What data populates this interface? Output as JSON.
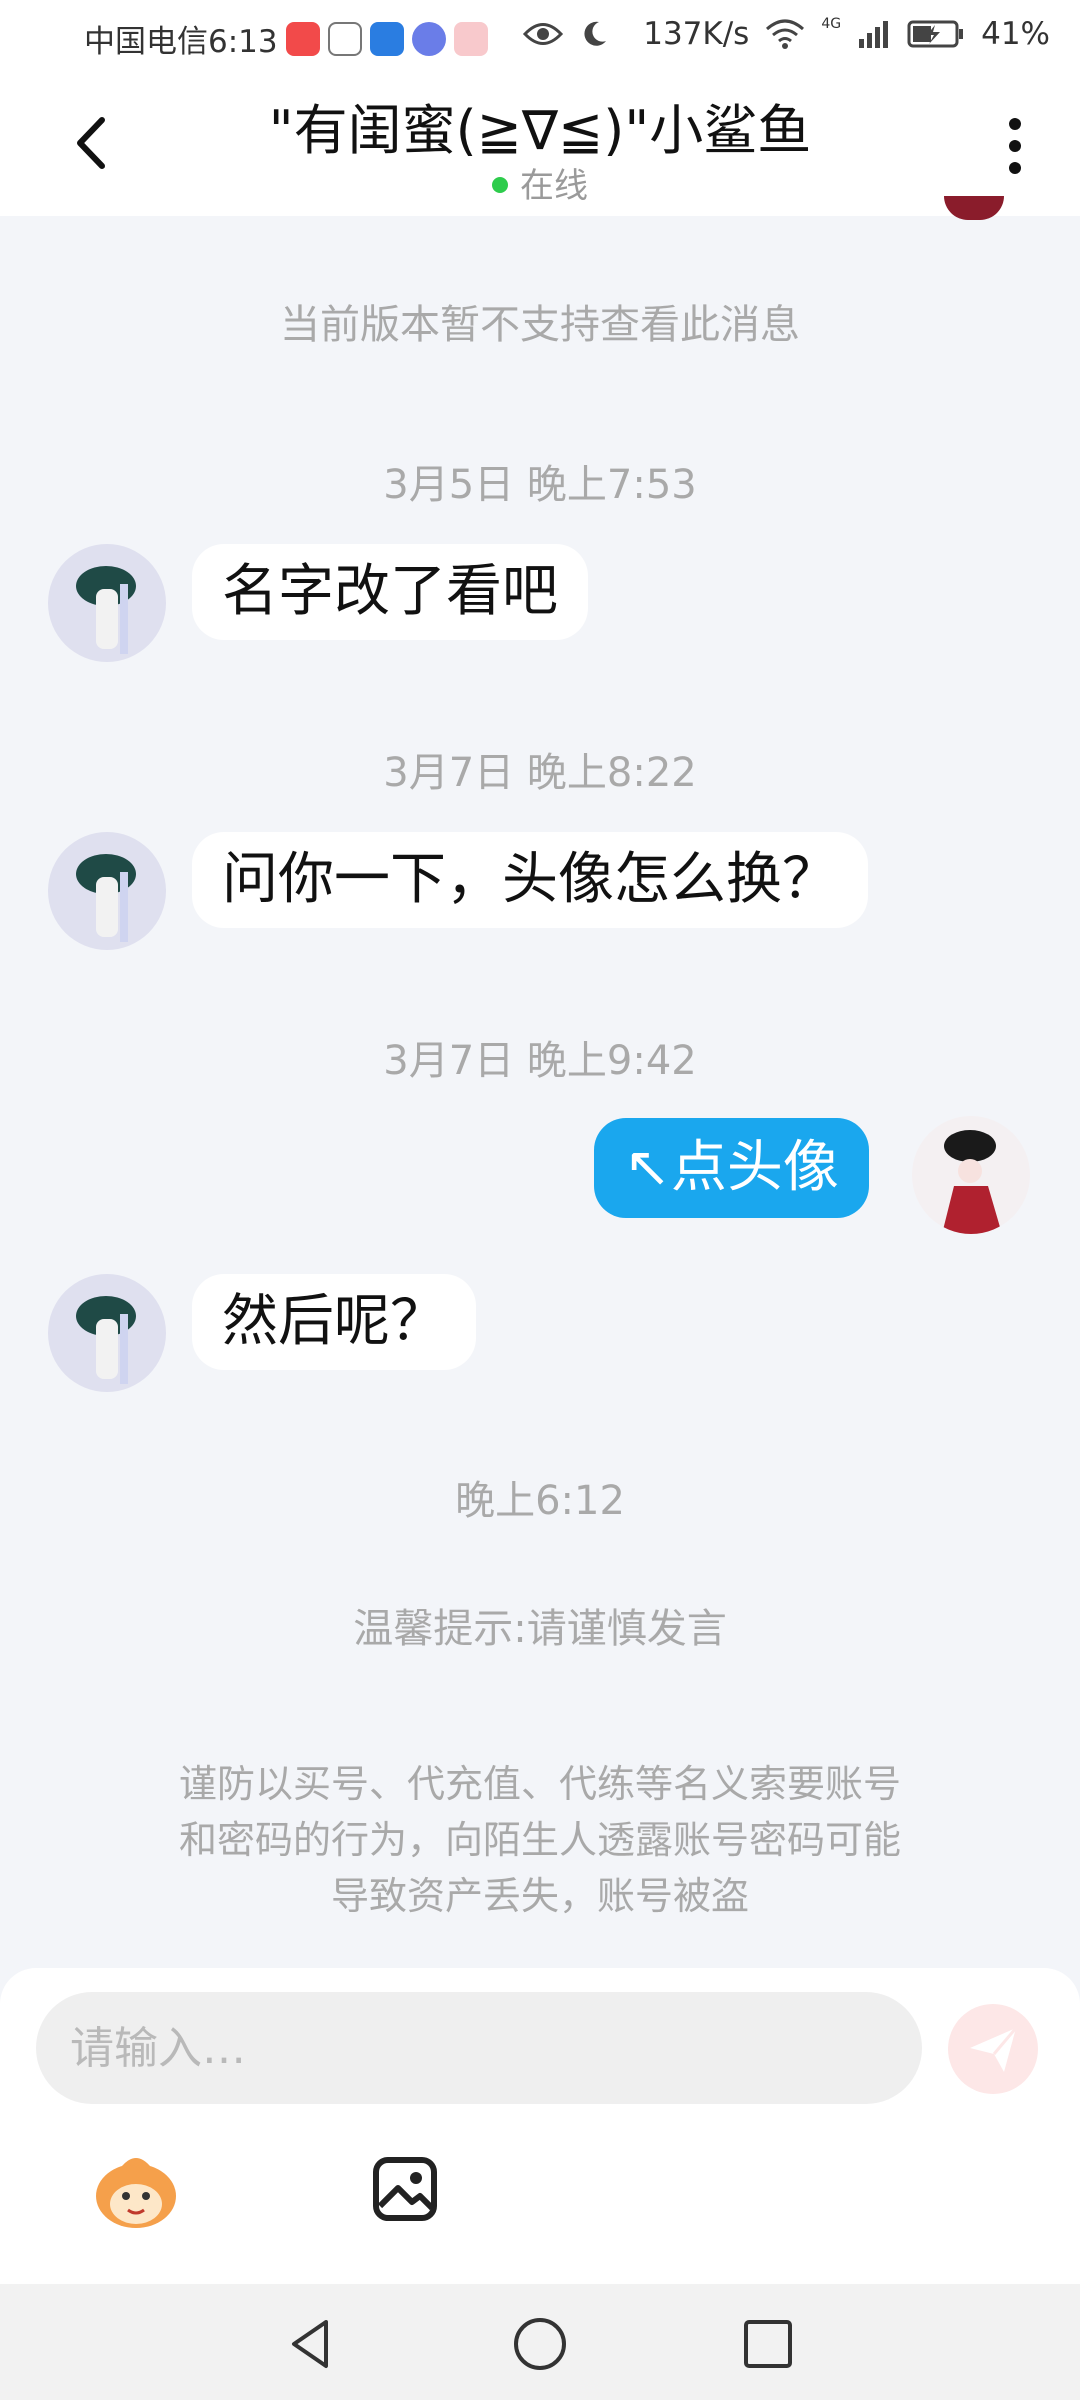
{
  "status_bar": {
    "carrier_time": "中国电信6:13",
    "speed": "137K/s",
    "network": "4G",
    "battery": "41%"
  },
  "header": {
    "title": "\"有闺蜜(≧∇≦)\"小鲨鱼",
    "status": "在线",
    "back_icon": "back-arrow-icon",
    "more_icon": "more-vertical-icon"
  },
  "chat": {
    "unsupported_notice": "当前版本暂不支持查看此消息",
    "timestamps": [
      "3月5日 晚上7:53",
      "3月7日 晚上8:22",
      "3月7日 晚上9:42",
      "晚上6:12"
    ],
    "messages": [
      {
        "from": "other",
        "text": "名字改了看吧"
      },
      {
        "from": "other",
        "text": "问你一下，头像怎么换？"
      },
      {
        "from": "me",
        "text": "↖点头像"
      },
      {
        "from": "other",
        "text": "然后呢？"
      }
    ],
    "tip": "温馨提示:请谨慎发言",
    "warning_lines": [
      "谨防以买号、代充值、代练等名义索要账号",
      "和密码的行为，向陌生人透露账号密码可能",
      "导致资产丢失，账号被盗"
    ]
  },
  "input": {
    "placeholder": "请输入…"
  },
  "colors": {
    "accent": "#1aa7ee",
    "background": "#f3f5f9",
    "online": "#2ecc4c"
  }
}
